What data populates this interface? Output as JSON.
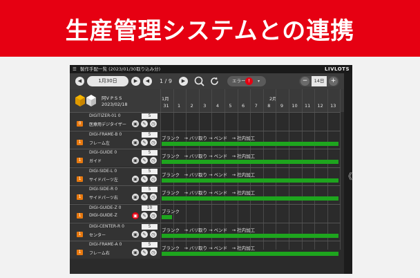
{
  "banner": {
    "title": "生産管理システムとの連携"
  },
  "window": {
    "title": "製作手配一覧 (2023/01/30取り込み分)",
    "brand": "LIVLOTS",
    "menu_icon": "menu-icon"
  },
  "toolbar": {
    "date_label": "1月30日",
    "page_label": "1 / 9",
    "error_label": "エラー",
    "error_count": "!",
    "zoom_label": "14日",
    "zoom_minus": "−",
    "zoom_plus": "+"
  },
  "side_toggle": "《",
  "header": {
    "project": "阿V P S S",
    "date": "2023/02/18",
    "months": [
      {
        "label": "1月"
      },
      {
        "label": "2月"
      }
    ],
    "days": [
      "31",
      "1",
      "2",
      "3",
      "4",
      "5",
      "6",
      "7",
      "8",
      "9",
      "10",
      "11",
      "12",
      "13"
    ]
  },
  "rows": [
    {
      "code": "DIGITIZER-01 0",
      "num": "0",
      "name": "医療用デジタイザー",
      "qty": "5",
      "process": "",
      "progress_days": 0
    },
    {
      "code": "DIGI-FRAME-B 0",
      "num": "1",
      "name": "フレーム左",
      "qty": "5",
      "process": "ブランク　→ バリ取り → ベンド　→ 社内加工",
      "progress_days": 14
    },
    {
      "code": "DIGI-GUIDE 0",
      "num": "1",
      "name": "ガイド",
      "qty": "5",
      "process": "ブランク　→ バリ取り → ベンド　→ 社内加工",
      "progress_days": 14
    },
    {
      "code": "DIGI-SIDE-L 0",
      "num": "1",
      "name": "サイドパーツ左",
      "qty": "5",
      "process": "ブランク　→ バリ取り → ベンド　→ 社内加工",
      "progress_days": 14
    },
    {
      "code": "DIGI-SIDE-R 0",
      "num": "1",
      "name": "サイドパーツ右",
      "qty": "5",
      "process": "ブランク　→ バリ取り → ベンド　→ 社内加工",
      "progress_days": 14
    },
    {
      "code": "DIGI-GUIDE-Z 0",
      "num": "1",
      "name": "DIGI-GUIDE-Z",
      "qty": "10",
      "process": "ブランク",
      "progress_days": 1
    },
    {
      "code": "DIGI-CENTER-R 0",
      "num": "1",
      "name": "センター",
      "qty": "5",
      "process": "ブランク　→ バリ取り → ベンド　→ 社内加工",
      "progress_days": 14
    },
    {
      "code": "DIGI-FRAME-A 0",
      "num": "1",
      "name": "フレーム右",
      "qty": "5",
      "process": "ブランク　→ バリ取り → ベンド　→ 社内加工",
      "progress_days": 14
    }
  ],
  "row_icons": [
    "folder-icon",
    "wrench-icon",
    "alarm-clock-icon"
  ],
  "colors": {
    "banner": "#e60012",
    "bar": "#1ea51e",
    "badge": "#e8790f",
    "alert": "#e60012"
  }
}
